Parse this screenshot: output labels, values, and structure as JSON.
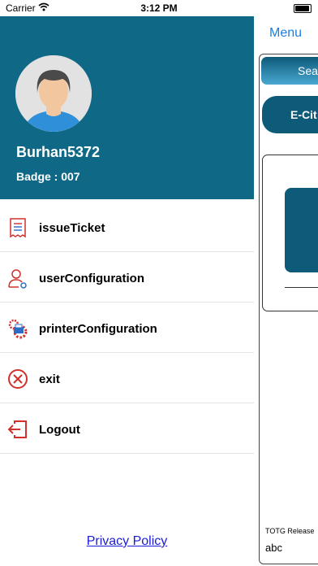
{
  "status_bar": {
    "carrier": "Carrier",
    "time": "3:12 PM"
  },
  "background": {
    "menu_label": "Menu",
    "search_label": "Sea",
    "ecitation_label": "E-Cit",
    "release_label": "TOTG Release",
    "release_value": "abc"
  },
  "drawer": {
    "username": "Burhan5372",
    "badge": "Badge : 007",
    "items": [
      {
        "label": "issueTicket",
        "icon": "receipt-icon"
      },
      {
        "label": "userConfiguration",
        "icon": "user-settings-icon"
      },
      {
        "label": "printerConfiguration",
        "icon": "printer-gear-icon"
      },
      {
        "label": "exit",
        "icon": "close-circle-icon"
      },
      {
        "label": "Logout",
        "icon": "logout-icon"
      }
    ],
    "privacy_policy": "Privacy Policy"
  },
  "colors": {
    "header": "#0f6986",
    "accent_red": "#d0312d",
    "link_blue": "#1a7ee0"
  }
}
